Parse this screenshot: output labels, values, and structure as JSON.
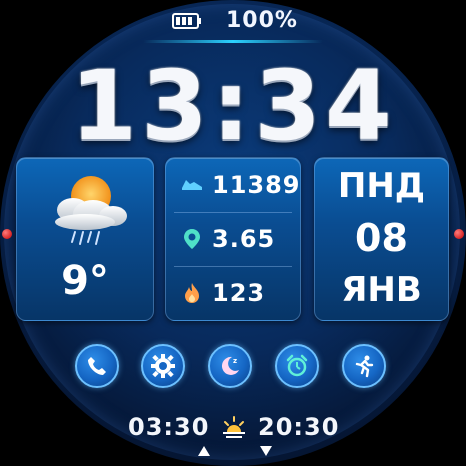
{
  "status": {
    "battery_text": "100%",
    "battery_level": 1.0
  },
  "time": {
    "display": "13:34"
  },
  "weather": {
    "temperature": "9°",
    "icon": "cloud-sun-rain-icon"
  },
  "stats": [
    {
      "value": "11389",
      "icon": "shoe-steps-icon",
      "color": "#5fd0ff"
    },
    {
      "value": "3.65",
      "icon": "location-pin-icon",
      "color": "#4fe0c8"
    },
    {
      "value": "123",
      "icon": "flame-icon",
      "color": "#ff9f4a"
    }
  ],
  "date": {
    "weekday": "ПНД",
    "day": "08",
    "month": "ЯНВ"
  },
  "apps": [
    {
      "name": "phone-icon"
    },
    {
      "name": "settings-icon"
    },
    {
      "name": "sleep-icon"
    },
    {
      "name": "alarm-icon"
    },
    {
      "name": "running-icon"
    }
  ],
  "sun": {
    "sunrise": "03:30",
    "sunset": "20:30"
  },
  "colors": {
    "accent": "#2bd2ff",
    "panel": "#0a4d92",
    "indicator": "#e01010"
  }
}
